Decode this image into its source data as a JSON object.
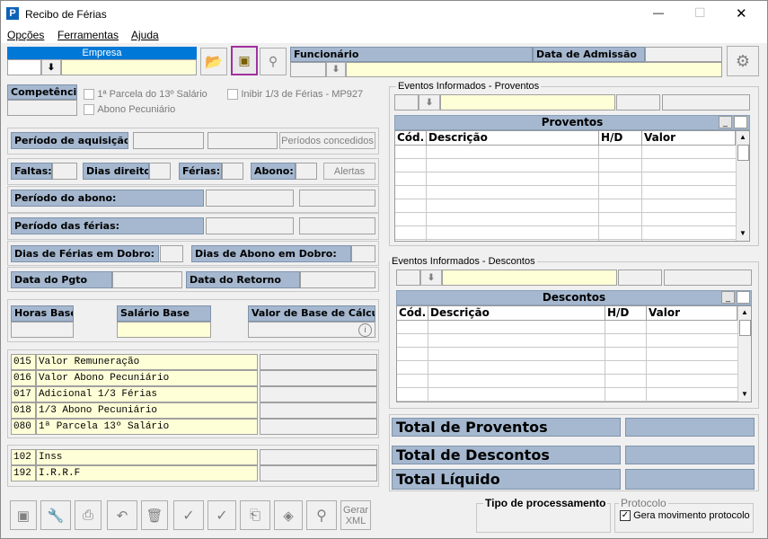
{
  "window": {
    "title": "Recibo de Férias",
    "controls": {
      "minimize": "—",
      "maximize": "☐",
      "close": "✕"
    }
  },
  "menu": [
    "Opções",
    "Ferramentas",
    "Ajuda"
  ],
  "header": {
    "empresa_label": "Empresa",
    "funcionario_label": "Funcionário",
    "admissao_label": "Data de Admissão"
  },
  "left": {
    "competencia_label": "Competência",
    "chk_13": "1ª Parcela do 13º Salário",
    "chk_inibir": "Inibir 1/3 de Férias - MP927",
    "chk_abono": "Abono Pecuniário",
    "periodo_aquisicao": "Período de aquisição:",
    "periodos_concedidos": "Períodos concedidos",
    "faltas": "Faltas:",
    "dias_direito": "Dias direito:",
    "ferias": "Férias:",
    "abono": "Abono:",
    "alertas": "Alertas",
    "periodo_abono": "Período do abono:",
    "periodo_ferias": "Período das férias:",
    "dias_ferias_dobro": "Dias de Férias em Dobro:",
    "dias_abono_dobro": "Dias de Abono em Dobro:",
    "data_pgto": "Data do Pgto",
    "data_retorno": "Data do Retorno",
    "horas_base": "Horas Base",
    "salario_base": "Salário Base",
    "valor_base_calculo": "Valor de Base de Cálculo"
  },
  "proventos_rows": [
    {
      "code": "015",
      "desc": "Valor Remuneração"
    },
    {
      "code": "016",
      "desc": "Valor Abono Pecuniário"
    },
    {
      "code": "017",
      "desc": "Adicional 1/3 Férias"
    },
    {
      "code": "018",
      "desc": "1/3 Abono Pecuniário"
    },
    {
      "code": "080",
      "desc": "1ª Parcela 13º Salário"
    }
  ],
  "descontos_rows": [
    {
      "code": "102",
      "desc": "Inss"
    },
    {
      "code": "192",
      "desc": "I.R.R.F"
    }
  ],
  "right": {
    "eventos_proventos": "Eventos Informados - Proventos",
    "proventos_title": "Proventos",
    "eventos_descontos": "Eventos Informados - Descontos",
    "descontos_title": "Descontos",
    "col_cod": "Cód.",
    "col_desc": "Descrição",
    "col_hd": "H/D",
    "col_valor": "Valor",
    "total_proventos": "Total de Proventos",
    "total_descontos": "Total de Descontos",
    "total_liquido": "Total Líquido",
    "tipo_processamento": "Tipo de processamento",
    "protocolo": "Protocolo",
    "gera_movimento": "Gera movimento protocolo"
  },
  "toolbar": {
    "gerar_xml": "Gerar XML"
  },
  "colors": {
    "header_blue": "#a5b8cf",
    "yellow": "#ffffd7",
    "highlight": "#a0309f",
    "app_icon": "#0d62b8"
  }
}
